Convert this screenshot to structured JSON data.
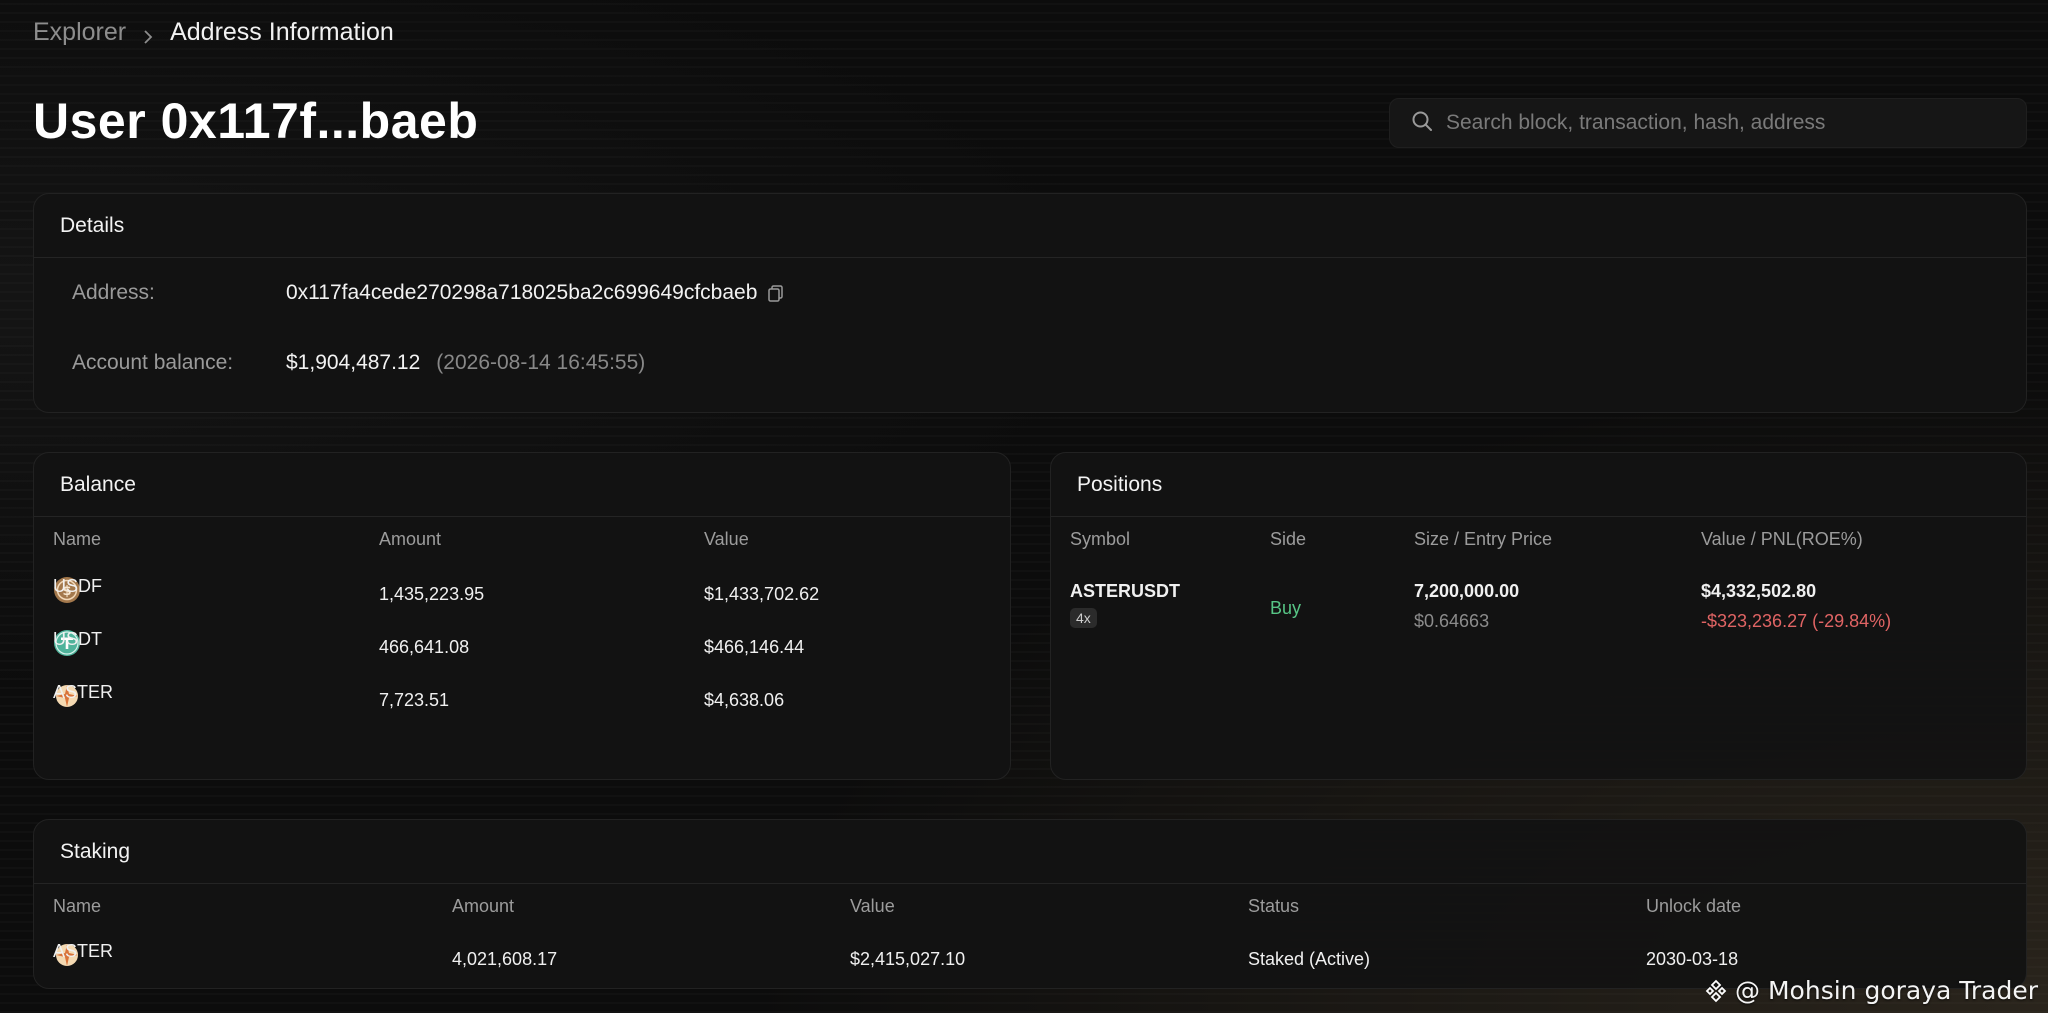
{
  "breadcrumb": {
    "root": "Explorer",
    "current": "Address Information"
  },
  "page": {
    "title": "User 0x117f...baeb"
  },
  "search": {
    "placeholder": "Search block, transaction, hash, address"
  },
  "details": {
    "header": "Details",
    "address_label": "Address:",
    "address_value": "0x117fa4cede270298a718025ba2c699649cfcbaeb",
    "balance_label": "Account balance:",
    "balance_value": "$1,904,487.12",
    "balance_time": "(2026-08-14 16:45:55)"
  },
  "balance": {
    "header": "Balance",
    "columns": [
      "Name",
      "Amount",
      "Value"
    ],
    "rows": [
      {
        "icon": "usdf-coin-icon",
        "name": "USDF",
        "amount": "1,435,223.95",
        "value": "$1,433,702.62"
      },
      {
        "icon": "usdt-coin-icon",
        "name": "USDT",
        "amount": "466,641.08",
        "value": "$466,146.44"
      },
      {
        "icon": "aster-coin-icon",
        "name": "ASTER",
        "amount": "7,723.51",
        "value": "$4,638.06"
      }
    ]
  },
  "positions": {
    "header": "Positions",
    "columns": [
      "Symbol",
      "Side",
      "Size / Entry Price",
      "Value / PNL(ROE%)"
    ],
    "rows": [
      {
        "symbol": "ASTERUSDT",
        "leverage": "4x",
        "side": "Buy",
        "size": "7,200,000.00",
        "entry_price": "$0.64663",
        "value": "$4,332,502.80",
        "pnl": "-$323,236.27 (-29.84%)"
      }
    ]
  },
  "staking": {
    "header": "Staking",
    "columns": [
      "Name",
      "Amount",
      "Value",
      "Status",
      "Unlock date"
    ],
    "rows": [
      {
        "icon": "aster-coin-icon",
        "name": "ASTER",
        "amount": "4,021,608.17",
        "value": "$2,415,027.10",
        "status": "Staked (Active)",
        "unlock": "2030-03-18"
      }
    ]
  },
  "watermark": {
    "text": "@ Mohsin goraya Trader"
  },
  "colors": {
    "buy": "#57c585",
    "pnl_negative": "#e06464",
    "card_bg": "#131313"
  }
}
